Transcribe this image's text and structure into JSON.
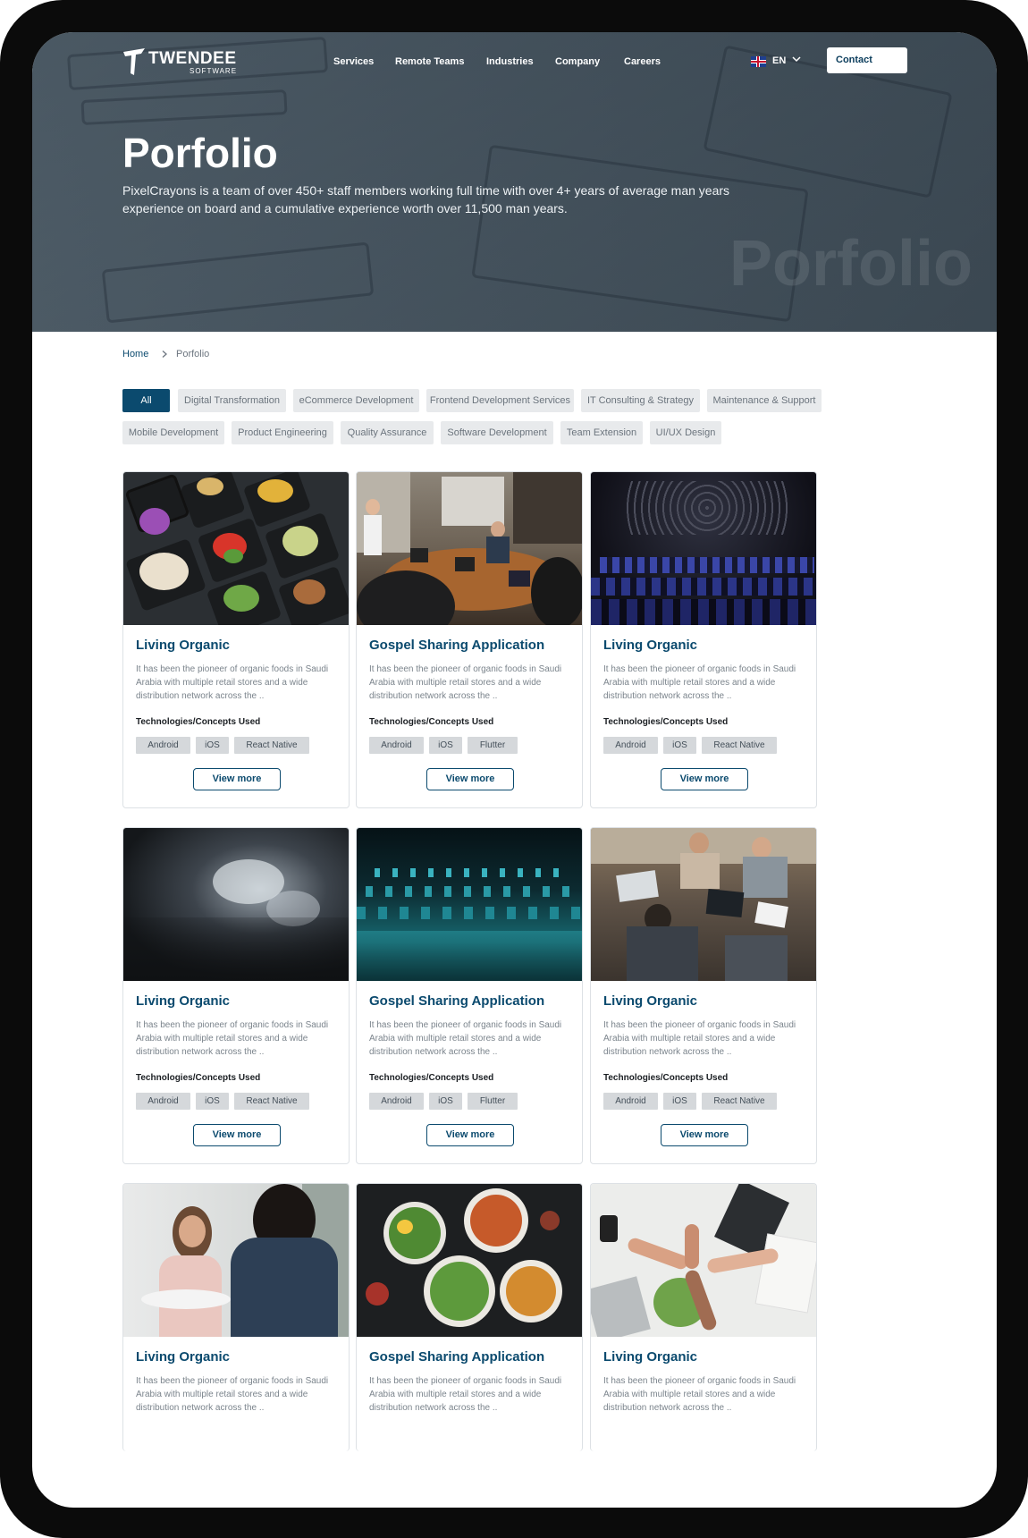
{
  "nav": {
    "logo_name": "TWENDEE",
    "logo_sub": "SOFTWARE",
    "links": [
      "Services",
      "Remote Teams",
      "Industries",
      "Company",
      "Careers"
    ],
    "lang": "EN",
    "contact": "Contact"
  },
  "hero": {
    "title": "Porfolio",
    "description": "PixelCrayons is a team of over 450+ staff members working full time with over 4+ years of average man years experience on board and a cumulative experience worth over 11,500 man years.",
    "watermark": "Porfolio"
  },
  "breadcrumb": {
    "home": "Home",
    "current": "Porfolio"
  },
  "filters": [
    "All",
    "Digital Transformation",
    "eCommerce Development",
    "Frontend Development Services",
    "IT Consulting & Strategy",
    "Maintenance & Support",
    "Mobile Development",
    "Product Engineering",
    "Quality Assurance",
    "Software Development",
    "Team Extension",
    "UI/UX Design"
  ],
  "cards": [
    {
      "title": "Living Organic",
      "desc": "It has been the pioneer of organic foods in Saudi Arabia with multiple retail stores and a wide distribution network across the ..",
      "tech_label": "Technologies/Concepts Used",
      "tags": [
        "Android",
        "iOS",
        "React Native"
      ],
      "button": "View more",
      "image": "food-containers"
    },
    {
      "title": "Gospel Sharing Application",
      "desc": "It has been the pioneer of organic foods in Saudi Arabia with multiple retail stores and a wide distribution network across the ..",
      "tech_label": "Technologies/Concepts Used",
      "tags": [
        "Android",
        "iOS",
        "Flutter"
      ],
      "button": "View more",
      "image": "meeting-room"
    },
    {
      "title": "Living Organic",
      "desc": "It has been the pioneer of organic foods in Saudi Arabia with multiple retail stores and a wide distribution network across the ..",
      "tech_label": "Technologies/Concepts Used",
      "tags": [
        "Android",
        "iOS",
        "React Native"
      ],
      "button": "View more",
      "image": "audience"
    },
    {
      "title": "Living Organic",
      "desc": "It has been the pioneer of organic foods in Saudi Arabia with multiple retail stores and a wide distribution network across the ..",
      "tech_label": "Technologies/Concepts Used",
      "tags": [
        "Android",
        "iOS",
        "React Native"
      ],
      "button": "View more",
      "image": "puzzle"
    },
    {
      "title": "Gospel Sharing Application",
      "desc": "It has been the pioneer of organic foods in Saudi Arabia with multiple retail stores and a wide distribution network across the ..",
      "tech_label": "Technologies/Concepts Used",
      "tags": [
        "Android",
        "iOS",
        "Flutter"
      ],
      "button": "View more",
      "image": "keyboard"
    },
    {
      "title": "Living Organic",
      "desc": "It has been the pioneer of organic foods in Saudi Arabia with multiple retail stores and a wide distribution network across the ..",
      "tech_label": "Technologies/Concepts Used",
      "tags": [
        "Android",
        "iOS",
        "React Native"
      ],
      "button": "View more",
      "image": "team-laptops"
    },
    {
      "title": "Living Organic",
      "desc": "It has been the pioneer of organic foods in Saudi Arabia with multiple retail stores and a wide distribution network across the ..",
      "image": "interview"
    },
    {
      "title": "Gospel Sharing Application",
      "desc": "It has been the pioneer of organic foods in Saudi Arabia with multiple retail stores and a wide distribution network across the ..",
      "image": "salad-bowls"
    },
    {
      "title": "Living Organic",
      "desc": "It has been the pioneer of organic foods in Saudi Arabia with multiple retail stores and a wide distribution network across the ..",
      "image": "team-fists"
    }
  ],
  "colors": {
    "brand": "#0b4a6e",
    "chip_bg": "#e8eaec",
    "tag_bg": "#d5d8db"
  }
}
